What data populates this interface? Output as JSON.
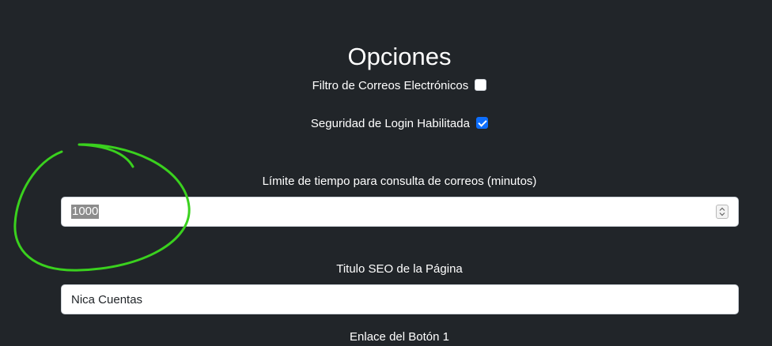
{
  "page": {
    "title": "Opciones"
  },
  "options": {
    "email_filter": {
      "label": "Filtro de Correos Electrónicos",
      "checked": false
    },
    "login_security": {
      "label": "Seguridad de Login Habilitada",
      "checked": true
    }
  },
  "fields": {
    "time_limit": {
      "label": "Límite de tiempo para consulta de correos (minutos)",
      "value": "1000"
    },
    "seo_title": {
      "label": "Titulo SEO de la Página",
      "value": "Nica Cuentas"
    },
    "button1_link": {
      "label": "Enlace del Botón 1"
    }
  },
  "colors": {
    "background": "#212529",
    "checkbox_checked": "#0d6efd",
    "annotation": "#3ad11e"
  },
  "icons": {
    "checkbox_checked": "check-icon",
    "spinner": "spinner-arrows-icon"
  }
}
